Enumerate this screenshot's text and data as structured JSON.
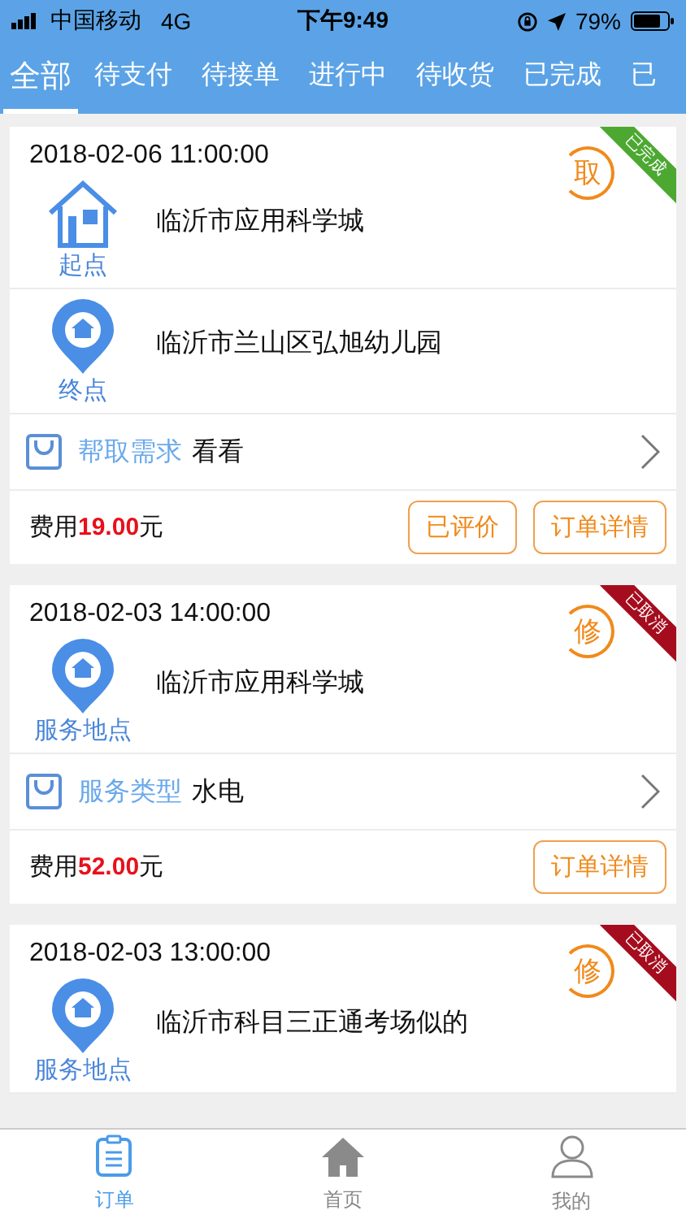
{
  "status_bar": {
    "carrier": "中国移动",
    "network": "4G",
    "time": "下午9:49",
    "battery": "79%"
  },
  "tabs": [
    {
      "label": "全部",
      "selected": true
    },
    {
      "label": "待支付",
      "selected": false
    },
    {
      "label": "待接单",
      "selected": false
    },
    {
      "label": "进行中",
      "selected": false
    },
    {
      "label": "待收货",
      "selected": false
    },
    {
      "label": "已完成",
      "selected": false
    },
    {
      "label": "已",
      "selected": false
    }
  ],
  "orders": [
    {
      "time": "2018-02-06 11:00:00",
      "badge": "取",
      "status_ribbon": {
        "text": "已完成",
        "color": "#4da832"
      },
      "locations": [
        {
          "kind": "house",
          "label": "起点",
          "address": "临沂市应用科学城"
        },
        {
          "kind": "pin",
          "label": "终点",
          "address": "临沂市兰山区弘旭幼儿园"
        }
      ],
      "detail": {
        "label": "帮取需求",
        "value": "看看"
      },
      "fee": {
        "prefix": "费用",
        "amount": "19.00",
        "suffix": "元"
      },
      "buttons": [
        "已评价",
        "订单详情"
      ]
    },
    {
      "time": "2018-02-03 14:00:00",
      "badge": "修",
      "status_ribbon": {
        "text": "已取消",
        "color": "#a50d1e"
      },
      "locations": [
        {
          "kind": "pin",
          "label": "服务地点",
          "address": "临沂市应用科学城"
        }
      ],
      "detail": {
        "label": "服务类型",
        "value": "水电"
      },
      "fee": {
        "prefix": "费用",
        "amount": "52.00",
        "suffix": "元"
      },
      "buttons": [
        "订单详情"
      ]
    },
    {
      "time": "2018-02-03 13:00:00",
      "badge": "修",
      "status_ribbon": {
        "text": "已取消",
        "color": "#a50d1e"
      },
      "locations": [
        {
          "kind": "pin",
          "label": "服务地点",
          "address": "临沂市科目三正通考场似的"
        }
      ]
    }
  ],
  "bottom_nav": [
    {
      "kind": "orders",
      "label": "订单",
      "selected": true
    },
    {
      "kind": "home",
      "label": "首页",
      "selected": false
    },
    {
      "kind": "profile",
      "label": "我的",
      "selected": false
    }
  ]
}
